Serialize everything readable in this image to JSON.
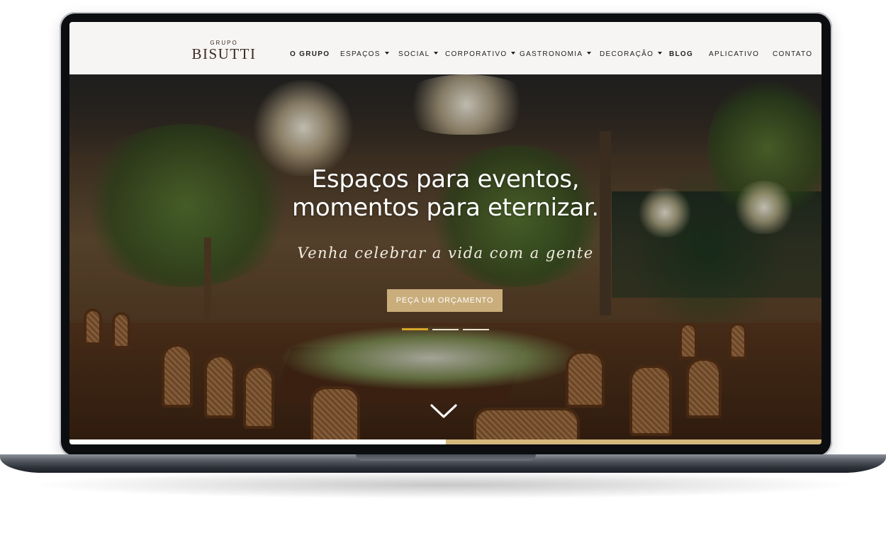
{
  "logo": {
    "top": "GRUPO",
    "main": "BISUTTI"
  },
  "nav": {
    "items": [
      {
        "label": "O GRUPO",
        "caret": false,
        "bold": true
      },
      {
        "label": "ESPAÇOS",
        "caret": true,
        "bold": false
      },
      {
        "label": "SOCIAL",
        "caret": true,
        "bold": false
      },
      {
        "label": "CORPORATIVO",
        "caret": true,
        "bold": false
      },
      {
        "label": "GASTRONOMIA",
        "caret": true,
        "bold": false
      },
      {
        "label": "DECORAÇÃO",
        "caret": true,
        "bold": false
      },
      {
        "label": "BLOG",
        "caret": false,
        "bold": true
      },
      {
        "label": "APLICATIVO",
        "caret": false,
        "bold": false
      },
      {
        "label": "CONTATO",
        "caret": false,
        "bold": false
      }
    ]
  },
  "hero": {
    "title_line1": "Espaços para eventos,",
    "title_line2": "momentos para eternizar.",
    "script": "Venha celebrar a vida com a gente",
    "cta_label": "PEÇA UM ORÇAMENTO",
    "slides_count": 3,
    "active_slide": 1,
    "progress": 0.5
  },
  "colors": {
    "accent": "#c9ad7b",
    "active_dot": "#d8a629",
    "nav_bg": "#f6f5f3",
    "logo": "#3a2a20"
  },
  "icons": {
    "scroll_down": "chevron-down-icon",
    "dropdown": "caret-down-icon"
  }
}
